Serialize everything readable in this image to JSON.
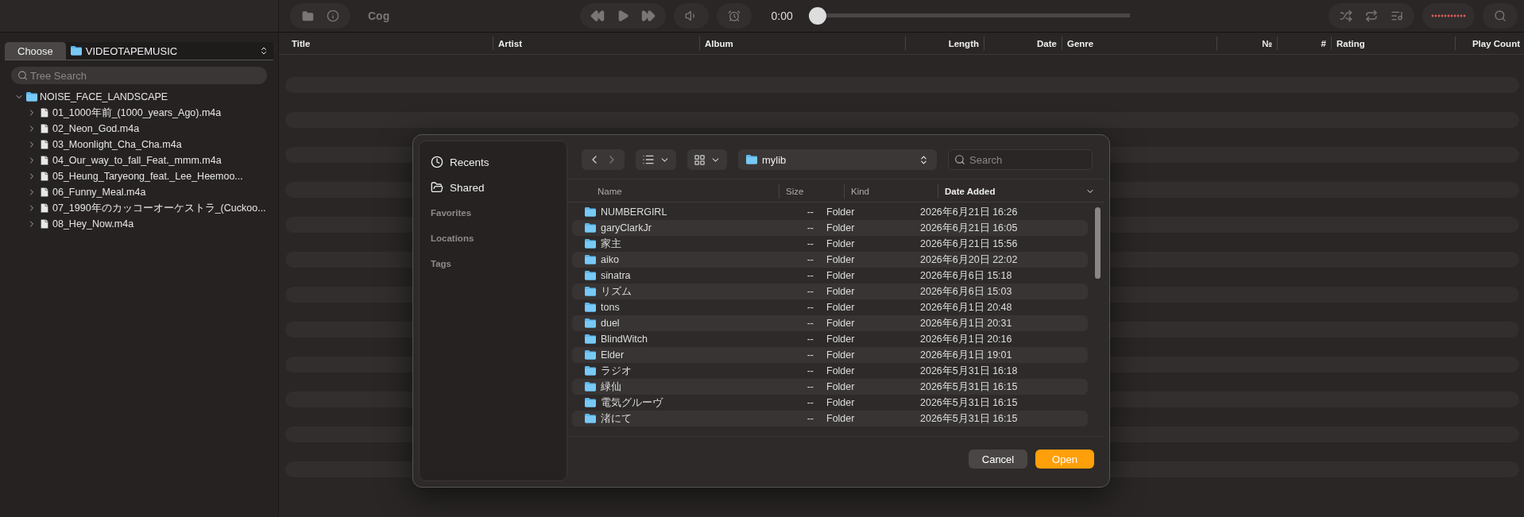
{
  "toolbar": {
    "title": "Cog",
    "time": "0:00",
    "seek": {
      "level": 0
    }
  },
  "sidebar": {
    "choose_button": "Choose",
    "folder_picker": "VIDEOTAPEMUSIC",
    "search": {
      "placeholder": "Tree Search"
    },
    "tree": [
      {
        "label": "NOISE_FACE_LANDSCAPE",
        "kind": "folder",
        "expanded": true,
        "children": [
          {
            "label": "01_1000年前_(1000_years_Ago).m4a",
            "kind": "file",
            "expanded": false
          },
          {
            "label": "02_Neon_God.m4a",
            "kind": "file",
            "expanded": false
          },
          {
            "label": "03_Moonlight_Cha_Cha.m4a",
            "kind": "file",
            "expanded": false
          },
          {
            "label": "04_Our_way_to_fall_Feat._mmm.m4a",
            "kind": "file",
            "expanded": false
          },
          {
            "label": "05_Heung_Taryeong_feat._Lee_Heemoo...",
            "kind": "file",
            "expanded": false
          },
          {
            "label": "06_Funny_Meal.m4a",
            "kind": "file",
            "expanded": false
          },
          {
            "label": "07_1990年のカッコーオーケストラ_(Cuckoo...",
            "kind": "file",
            "expanded": false
          },
          {
            "label": "08_Hey_Now.m4a",
            "kind": "file",
            "expanded": false
          }
        ]
      }
    ]
  },
  "playlist": {
    "columns": [
      "Title",
      "Artist",
      "Album",
      "Length",
      "Date",
      "Genre",
      "№",
      "#",
      "Rating",
      "Play Count"
    ]
  },
  "dialog": {
    "sidebar": [
      {
        "label": "Recents",
        "kind": "item"
      },
      {
        "label": "Shared",
        "kind": "item"
      },
      {
        "label": "Favorites",
        "kind": "section"
      },
      {
        "label": "Locations",
        "kind": "section"
      },
      {
        "label": "Tags",
        "kind": "section"
      }
    ],
    "location": "mylib",
    "search": {
      "placeholder": "Search"
    },
    "columns": [
      {
        "label": "Name",
        "sorted": false
      },
      {
        "label": "Size",
        "sorted": false
      },
      {
        "label": "Kind",
        "sorted": false
      },
      {
        "label": "Date Added",
        "sorted": true
      }
    ],
    "rows": [
      {
        "name": "NUMBERGIRL",
        "size": "--",
        "kind": "Folder",
        "date_added": "2026年6月21日 16:26"
      },
      {
        "name": "garyClarkJr",
        "size": "--",
        "kind": "Folder",
        "date_added": "2026年6月21日 16:05"
      },
      {
        "name": "家主",
        "size": "--",
        "kind": "Folder",
        "date_added": "2026年6月21日 15:56"
      },
      {
        "name": "aiko",
        "size": "--",
        "kind": "Folder",
        "date_added": "2026年6月20日 22:02"
      },
      {
        "name": "sinatra",
        "size": "--",
        "kind": "Folder",
        "date_added": "2026年6月6日 15:18"
      },
      {
        "name": "リズム",
        "size": "--",
        "kind": "Folder",
        "date_added": "2026年6月6日 15:03"
      },
      {
        "name": "tons",
        "size": "--",
        "kind": "Folder",
        "date_added": "2026年6月1日 20:48"
      },
      {
        "name": "duel",
        "size": "--",
        "kind": "Folder",
        "date_added": "2026年6月1日 20:31"
      },
      {
        "name": "BlindWitch",
        "size": "--",
        "kind": "Folder",
        "date_added": "2026年6月1日 20:16"
      },
      {
        "name": "Elder",
        "size": "--",
        "kind": "Folder",
        "date_added": "2026年6月1日 19:01"
      },
      {
        "name": "ラジオ",
        "size": "--",
        "kind": "Folder",
        "date_added": "2026年5月31日 16:18"
      },
      {
        "name": "緑仙",
        "size": "--",
        "kind": "Folder",
        "date_added": "2026年5月31日 16:15"
      },
      {
        "name": "電気グルーヴ",
        "size": "--",
        "kind": "Folder",
        "date_added": "2026年5月31日 16:15"
      },
      {
        "name": "渚にて",
        "size": "--",
        "kind": "Folder",
        "date_added": "2026年5月31日 16:15"
      }
    ],
    "buttons": [
      {
        "label": "Cancel",
        "primary": false
      },
      {
        "label": "Open",
        "primary": true
      }
    ]
  }
}
